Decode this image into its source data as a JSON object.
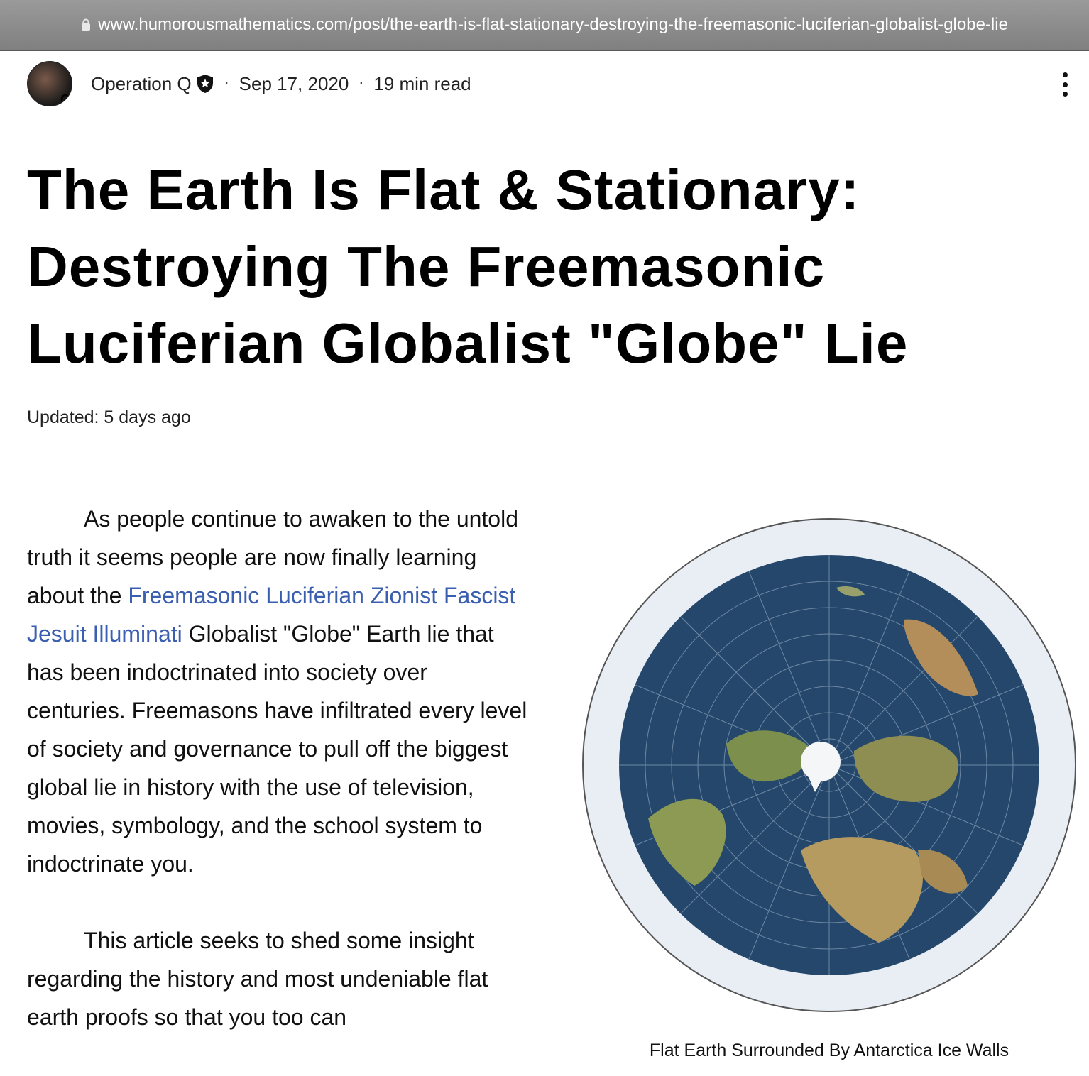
{
  "browser": {
    "url": "www.humorousmathematics.com/post/the-earth-is-flat-stationary-destroying-the-freemasonic-luciferian-globalist-globe-lie"
  },
  "post_meta": {
    "author": "Operation Q",
    "date": "Sep 17, 2020",
    "read_time": "19 min read",
    "separator": "·"
  },
  "article": {
    "title": "The Earth Is Flat & Stationary: Destroying The Freemasonic Luciferian Globalist \"Globe\" Lie",
    "updated": "Updated: 5 days ago",
    "p1_before_link": "As people continue to awaken to the untold truth it seems people are now finally learning about the ",
    "p1_link": "Freemasonic Luciferian Zionist Fascist Jesuit Illuminati",
    "p1_after_link": " Globalist \"Globe\" Earth lie that has been indoctrinated into society over centuries. Freemasons have infiltrated every level of society and governance to pull off the biggest global lie in history with the use of television, movies, symbology, and the school system to indoctrinate you.",
    "p2": "This article seeks to shed some insight regarding the history and most undeniable flat earth proofs so that you too can"
  },
  "figure": {
    "caption": "Flat Earth Surrounded By Antarctica Ice Walls"
  },
  "colors": {
    "link": "#3b5fb0",
    "ocean": "#24476b",
    "ice": "#e8ecf3"
  }
}
